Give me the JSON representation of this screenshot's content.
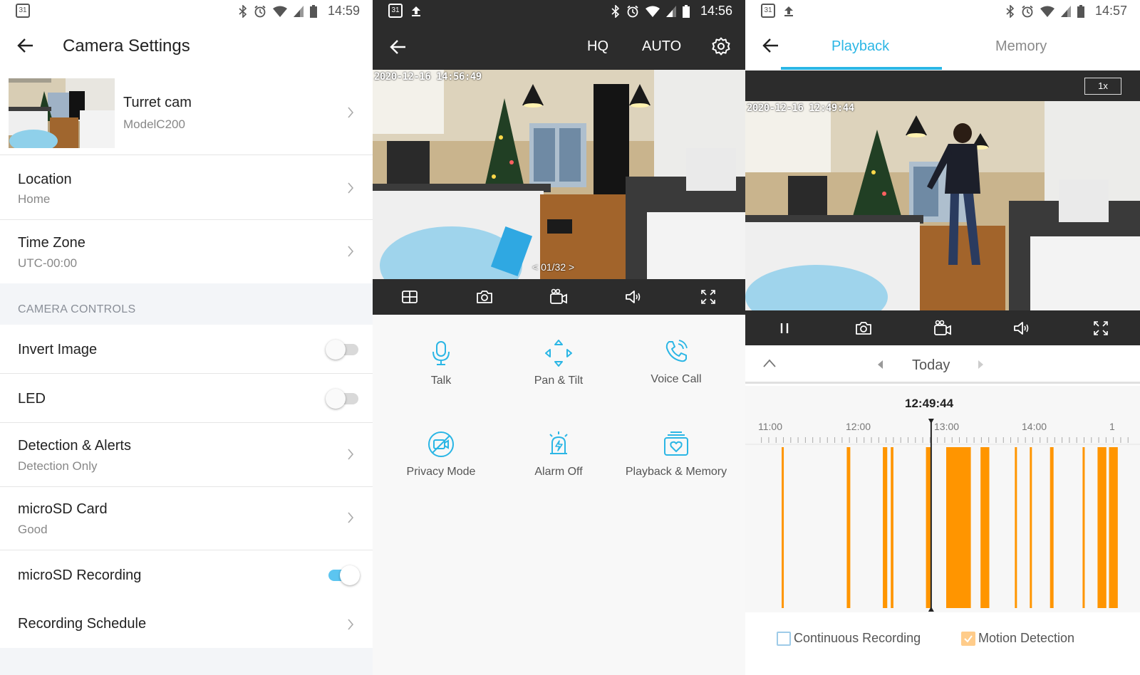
{
  "colors": {
    "accent": "#2bb6e5",
    "toggle_on": "#5cc5f0",
    "recording_orange": "#ff9500",
    "dark_bar": "#2c2c2c"
  },
  "screen1": {
    "status": {
      "calendar_day": "31",
      "time": "14:59"
    },
    "title": "Camera Settings",
    "camera": {
      "name": "Turret cam",
      "model": "ModelC200"
    },
    "location": {
      "label": "Location",
      "value": "Home"
    },
    "timezone": {
      "label": "Time Zone",
      "value": "UTC-00:00"
    },
    "section_header": "CAMERA CONTROLS",
    "invert_image": {
      "label": "Invert Image",
      "on": false
    },
    "led": {
      "label": "LED",
      "on": false
    },
    "detection": {
      "label": "Detection & Alerts",
      "value": "Detection Only"
    },
    "microsd_card": {
      "label": "microSD Card",
      "value": "Good"
    },
    "microsd_recording": {
      "label": "microSD Recording",
      "on": true
    },
    "recording_schedule": {
      "label": "Recording Schedule"
    }
  },
  "screen2": {
    "status": {
      "calendar_day": "31",
      "time": "14:56"
    },
    "quality_label": "HQ",
    "mode_label": "AUTO",
    "timestamp": "2020-12-16  14:56:49",
    "pager": "<  01/32  >",
    "controls": [
      "grid-icon",
      "camera-icon",
      "record-icon",
      "speaker-icon",
      "fullscreen-icon"
    ],
    "tiles": {
      "talk": "Talk",
      "pan_tilt": "Pan & Tilt",
      "voice_call": "Voice Call",
      "privacy_mode": "Privacy Mode",
      "alarm_off": "Alarm Off",
      "playback_memory": "Playback & Memory"
    }
  },
  "screen3": {
    "status": {
      "calendar_day": "31",
      "time": "14:57"
    },
    "tab_playback": "Playback",
    "tab_memory": "Memory",
    "zoom": "1x",
    "timestamp": "2020-12-16  12:49:44",
    "day": "Today",
    "current_time": "12:49:44",
    "hours": [
      "11:00",
      "12:00",
      "13:00",
      "14:00",
      "1"
    ],
    "motion_segments_hours": [
      [
        11.13,
        11.15
      ],
      [
        11.87,
        11.91
      ],
      [
        12.28,
        12.33
      ],
      [
        12.37,
        12.4
      ],
      [
        12.77,
        12.83
      ],
      [
        13.0,
        13.28
      ],
      [
        13.39,
        13.49
      ],
      [
        13.78,
        13.8
      ],
      [
        13.95,
        13.97
      ],
      [
        14.18,
        14.22
      ],
      [
        14.55,
        14.57
      ],
      [
        14.72,
        14.82
      ],
      [
        14.85,
        14.95
      ]
    ],
    "legend_continuous": "Continuous Recording",
    "legend_motion": "Motion Detection"
  }
}
